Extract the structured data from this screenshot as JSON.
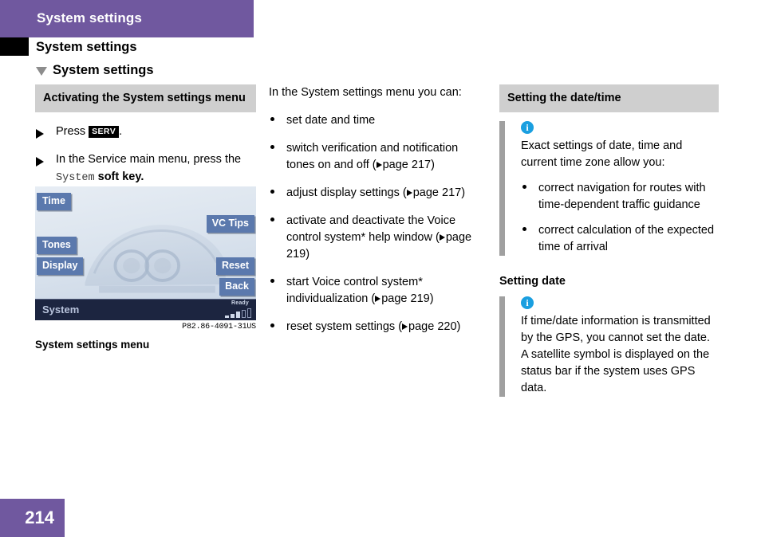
{
  "page": {
    "running_head": "System settings",
    "chapter_title": "System settings",
    "section_title": "System settings",
    "folio": "214",
    "accent_color": "#70589f",
    "gray_bar_color": "#cfcfcf",
    "info_icon_color": "#1a9fe0"
  },
  "left_column": {
    "heading": "Activating the System settings menu",
    "steps": [
      {
        "pre": "Press ",
        "key": "SERV",
        "post": "."
      },
      {
        "pre": "In the Service main menu, press the ",
        "key": "System",
        "post": " soft key."
      }
    ],
    "figure": {
      "buttons_left": [
        "Time",
        "Tones",
        "Display"
      ],
      "buttons_right": [
        "VC Tips",
        "Reset",
        "Back"
      ],
      "status_label": "System",
      "status_ready": "Ready",
      "button_color": "#5b79ad",
      "statusbar_color": "#1c2540",
      "code": "P82.86-4091-31US",
      "caption": "System settings menu"
    }
  },
  "middle_column": {
    "lead": "In the System settings menu you can:",
    "bullets": [
      {
        "text": "set date and time",
        "ref": ""
      },
      {
        "text": "switch verification and notification tones on and off (",
        "ref": "page 217",
        "close": ")"
      },
      {
        "text": "adjust display settings (",
        "ref": "page 217",
        "close": ")"
      },
      {
        "text": "activate and deactivate the Voice control system* help window (",
        "ref": "page 219",
        "close": ")"
      },
      {
        "text": "start Voice control system* individualization (",
        "ref": "page 219",
        "close": ")"
      },
      {
        "text": "reset system settings (",
        "ref": "page 220",
        "close": ")"
      }
    ]
  },
  "right_column": {
    "heading_1": "Setting the date/time",
    "note_1": {
      "icon": "info-icon",
      "text": "Exact settings of date, time and current time zone allow you:",
      "bullets": [
        "correct navigation for routes with time-dependent traffic guidance",
        "correct calculation of the expected time of arrival"
      ]
    },
    "heading_2": "Setting date",
    "note_2": {
      "icon": "info-icon",
      "text": "If time/date information is transmitted by the GPS, you cannot set the date. A satellite symbol is displayed on the status bar if the system uses GPS data."
    }
  }
}
